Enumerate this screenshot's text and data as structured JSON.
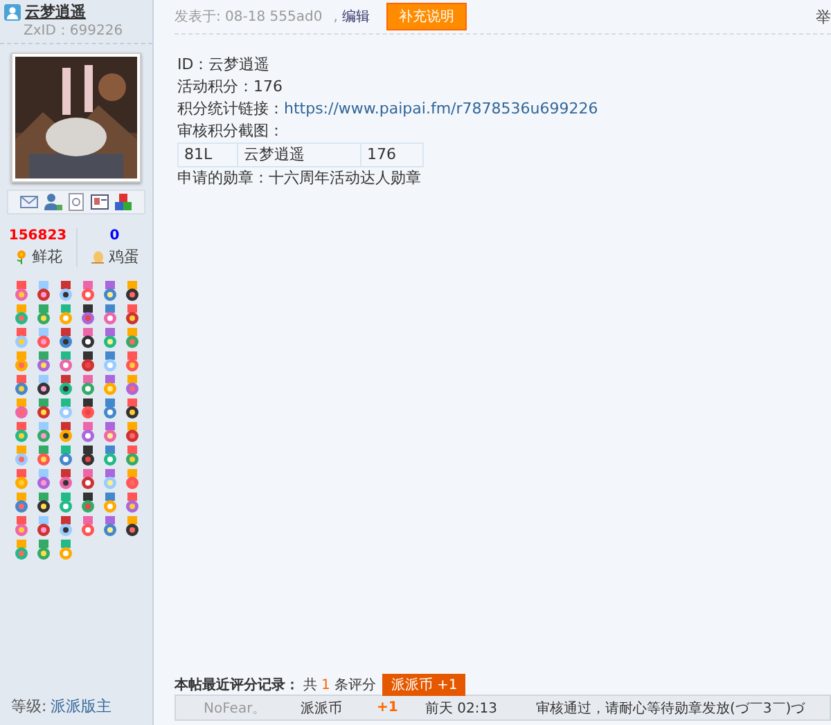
{
  "user": {
    "name": "云梦逍遥",
    "zxid": "ZxID：699226",
    "stats": [
      {
        "value": "156823",
        "label": "鲜花",
        "kind": "flower"
      },
      {
        "value": "0",
        "label": "鸡蛋",
        "kind": "egg"
      }
    ],
    "level_label": "等级:",
    "level": "派派版主"
  },
  "post": {
    "posted": "发表于: 08-18 555ad0",
    "edit_sep": ",",
    "edit": "编辑",
    "supplement_button": "补充说明",
    "right_cut": "举",
    "lines": [
      {
        "kind": "text",
        "text": "ID：云梦逍遥"
      },
      {
        "kind": "text",
        "text": "活动积分：176"
      },
      {
        "kind": "link",
        "label": "积分统计链接：",
        "url": "https://www.paipai.fm/r7878536u699226"
      },
      {
        "kind": "text",
        "text": "审核积分截图："
      },
      {
        "kind": "table",
        "cells": [
          "81L",
          "云梦逍遥",
          "176"
        ]
      },
      {
        "kind": "text",
        "text": "申请的勋章：十六周年活动达人勋章"
      }
    ]
  },
  "ratings": {
    "title": "本帖最近评分记录：",
    "count_pre": "共",
    "count": "1",
    "count_post": "条评分",
    "badge": "派派币 +1",
    "rows": [
      {
        "user": "NoFear。",
        "currency": "派派币",
        "amount": "+1",
        "time": "前天 02:13",
        "reason": "审核通过，请耐心等待勋章发放(づ￣3￣)づ"
      }
    ]
  }
}
